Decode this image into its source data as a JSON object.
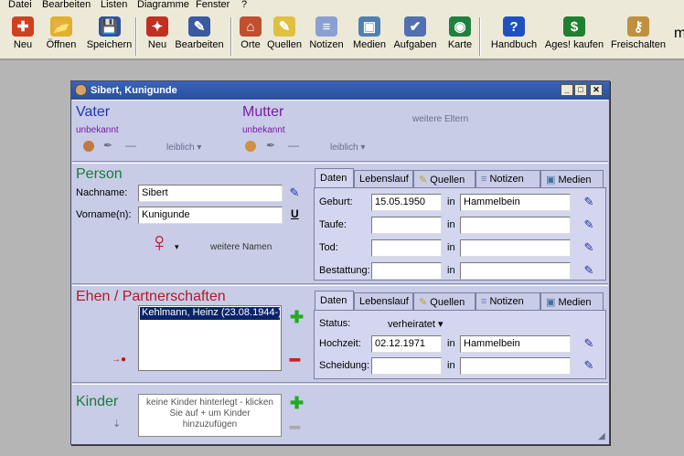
{
  "menu": [
    "Datei",
    "Bearbeiten",
    "Listen",
    "Diagramme",
    "Fenster",
    "?"
  ],
  "toolbar": [
    {
      "label": "Neu",
      "icon": "new-person-icon",
      "color": "#d04020",
      "glyph": "✚"
    },
    {
      "label": "Öffnen",
      "icon": "open-folder-icon",
      "color": "#e0b030",
      "glyph": "📂"
    },
    {
      "label": "Speichern",
      "icon": "save-disk-icon",
      "color": "#3050a0",
      "glyph": "💾"
    },
    {
      "label": "Neu",
      "icon": "new-entry-icon",
      "color": "#c03020",
      "glyph": "✦"
    },
    {
      "label": "Bearbeiten",
      "icon": "edit-person-icon",
      "color": "#3a5aa0",
      "glyph": "✎"
    },
    {
      "label": "Orte",
      "icon": "places-house-icon",
      "color": "#c05030",
      "glyph": "⌂"
    },
    {
      "label": "Quellen",
      "icon": "sources-icon",
      "color": "#e0c040",
      "glyph": "✎"
    },
    {
      "label": "Notizen",
      "icon": "notes-icon",
      "color": "#8aa0d0",
      "glyph": "≡"
    },
    {
      "label": "Medien",
      "icon": "media-icon",
      "color": "#5080b0",
      "glyph": "▣"
    },
    {
      "label": "Aufgaben",
      "icon": "tasks-icon",
      "color": "#5070b0",
      "glyph": "✔"
    },
    {
      "label": "Karte",
      "icon": "globe-map-icon",
      "color": "#208040",
      "glyph": "◉"
    },
    {
      "label": "Handbuch",
      "icon": "help-manual-icon",
      "color": "#2050c0",
      "glyph": "?"
    },
    {
      "label": "Ages! kaufen",
      "icon": "buy-icon",
      "color": "#208030",
      "glyph": "$"
    },
    {
      "label": "Freischalten",
      "icon": "unlock-key-icon",
      "color": "#c09040",
      "glyph": "⚷"
    }
  ],
  "toolbar_overflow": "m",
  "window": {
    "title": "Sibert, Kunigunde"
  },
  "parents": {
    "father_title": "Vater",
    "father_value": "unbekannt",
    "father_relation": "leiblich",
    "mother_title": "Mutter",
    "mother_value": "unbekannt",
    "mother_relation": "leiblich",
    "more_parents": "weitere Eltern"
  },
  "person": {
    "title": "Person",
    "surname_label": "Nachname:",
    "surname": "Sibert",
    "given_label": "Vorname(n):",
    "given": "Kunigunde",
    "underline_btn": "U",
    "more_names": "weitere Namen"
  },
  "person_tabs": [
    "Daten",
    "Lebenslauf",
    "Quellen",
    "Notizen",
    "Medien"
  ],
  "events": [
    {
      "label": "Geburt:",
      "date": "15.05.1950",
      "in": "in",
      "place": "Hammelbein"
    },
    {
      "label": "Taufe:",
      "date": "",
      "in": "in",
      "place": ""
    },
    {
      "label": "Tod:",
      "date": "",
      "in": "in",
      "place": ""
    },
    {
      "label": "Bestattung:",
      "date": "",
      "in": "in",
      "place": ""
    }
  ],
  "marriages": {
    "title": "Ehen / Partnerschaften",
    "items": [
      "Kehlmann, Heinz (23.08.1944-)"
    ],
    "status_label": "Status:",
    "status": "verheiratet",
    "events": [
      {
        "label": "Hochzeit:",
        "date": "02.12.1971",
        "in": "in",
        "place": "Hammelbein"
      },
      {
        "label": "Scheidung:",
        "date": "",
        "in": "in",
        "place": ""
      }
    ]
  },
  "children": {
    "title": "Kinder",
    "empty_text": "keine Kinder hinterlegt - klicken Sie auf + um Kinder hinzuzufügen"
  },
  "colors": {
    "blue_heading": "#2233aa",
    "purple_heading": "#7a1aa8",
    "green_heading": "#1a7a3a",
    "red_heading": "#b01a2a",
    "window_bg": "#c8cce6"
  }
}
